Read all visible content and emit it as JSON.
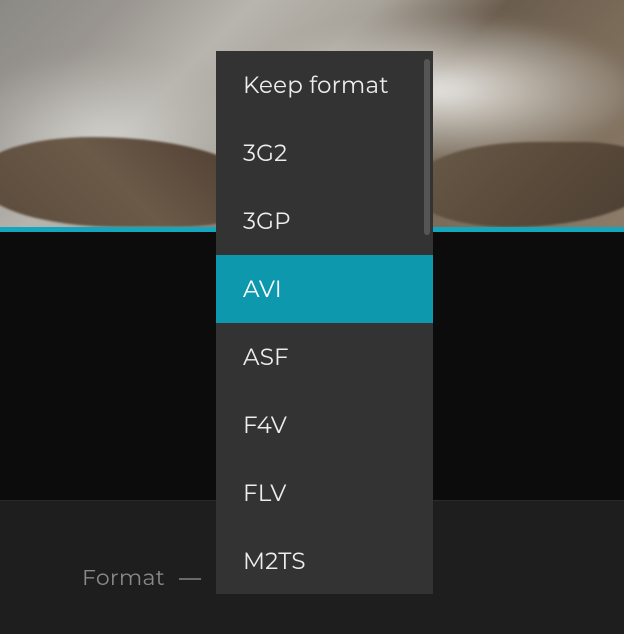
{
  "accent_color": "#14a6bd",
  "format": {
    "label": "Format",
    "selected": "AVI",
    "options": [
      "Keep format",
      "3G2",
      "3GP",
      "AVI",
      "ASF",
      "F4V",
      "FLV",
      "M2TS"
    ]
  }
}
